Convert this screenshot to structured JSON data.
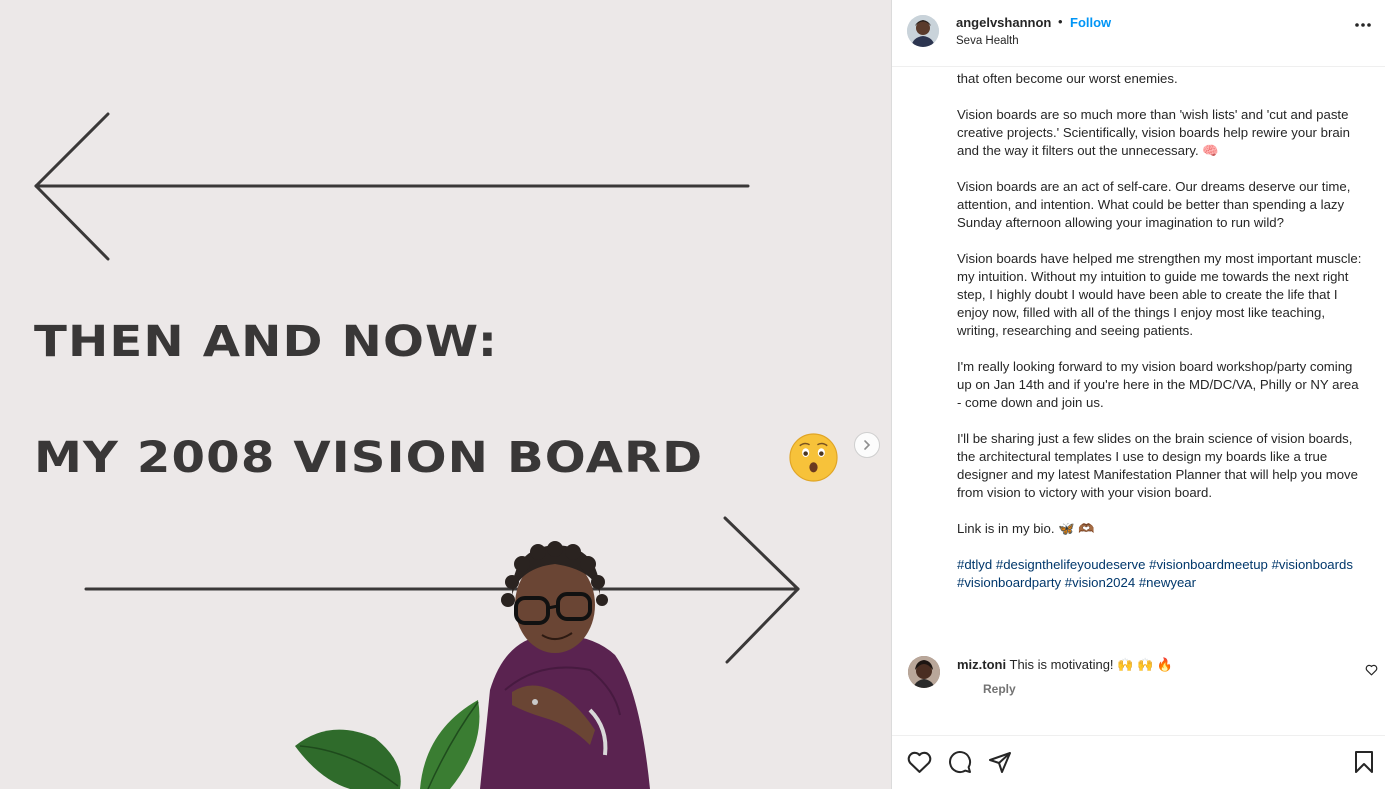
{
  "media": {
    "headline_line1": "THEN AND NOW:",
    "headline_line2": "MY 2008 VISION BOARD",
    "next_icon": "chevron-right-icon",
    "colors": {
      "background": "#ece8e8",
      "text": "#393737"
    }
  },
  "header": {
    "username": "angelvshannon",
    "separator": "•",
    "follow_label": "Follow",
    "location": "Seva Health",
    "more_icon": "more-horizontal-icon"
  },
  "caption": {
    "top_fragment": "that often become our worst enemies.",
    "p1": "Vision boards are so much more than 'wish lists' and 'cut and paste creative projects.' Scientifically, vision boards help rewire your brain and the way it filters out the unnecessary. 🧠",
    "p2": "Vision boards are an act of self-care. Our dreams deserve our time, attention, and intention. What could be better than spending a lazy Sunday afternoon allowing your imagination to run wild?",
    "p3": "Vision boards have helped me strengthen my most important muscle: my intuition. Without my intuition to guide me towards the next right step, I highly doubt I would have been able to create the life that I enjoy now, filled with all of the things I enjoy most like teaching, writing, researching and seeing patients.",
    "p4": "I'm really looking forward to my vision board workshop/party coming up on Jan 14th and if you're here in the MD/DC/VA, Philly or NY area - come down and join us.",
    "p5": "I'll be sharing just a few slides on the brain science of vision boards, the architectural templates I use to design my boards like a true designer and my latest Manifestation Planner that will help you move from vision to victory with your vision board.",
    "p6": "Link is in my bio. 🦋 🫶🏾",
    "hashtags": [
      "#dtlyd",
      "#designthelifeyoudeserve",
      "#visionboardmeetup",
      "#visionboards",
      "#visionboardparty",
      "#vision2024",
      "#newyear"
    ]
  },
  "comment": {
    "username": "miz.toni",
    "text": "This is motivating! 🙌 🙌 🔥",
    "reply_label": "Reply",
    "like_icon": "heart-outline-icon"
  },
  "actions": {
    "like_icon": "heart-icon",
    "comment_icon": "comment-icon",
    "share_icon": "send-icon",
    "save_icon": "bookmark-icon"
  }
}
